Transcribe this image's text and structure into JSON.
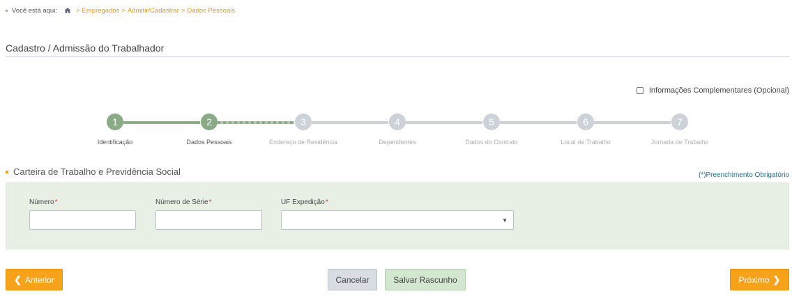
{
  "breadcrumb": {
    "prefix": "Você está aqui:",
    "items": [
      "Empregados",
      "Admitir/Cadastrar",
      "Dados Pessoais"
    ],
    "separator": ">"
  },
  "page_title": "Cadastro / Admissão do Trabalhador",
  "complementary": {
    "label": "Informações Complementares (Opcional)",
    "checked": false
  },
  "steps": [
    {
      "number": "1",
      "label": "Identificação",
      "status": "done"
    },
    {
      "number": "2",
      "label": "Dados Pessoais",
      "status": "done"
    },
    {
      "number": "3",
      "label": "Endereço de Residência",
      "status": "todo"
    },
    {
      "number": "4",
      "label": "Dependentes",
      "status": "todo"
    },
    {
      "number": "5",
      "label": "Dados do Contrato",
      "status": "todo"
    },
    {
      "number": "6",
      "label": "Local de Trabalho",
      "status": "todo"
    },
    {
      "number": "7",
      "label": "Jornada de Trabalho",
      "status": "todo"
    }
  ],
  "section": {
    "title": "Carteira de Trabalho e Previdência Social",
    "required_note": "(*)Preenchimento Obrigatório"
  },
  "fields": {
    "numero": {
      "label": "Número",
      "required_mark": "*",
      "value": ""
    },
    "serie": {
      "label": "Número de Série",
      "required_mark": "*",
      "value": ""
    },
    "uf": {
      "label": "UF Expedição",
      "required_mark": "*",
      "value": ""
    }
  },
  "buttons": {
    "previous": "Anterior",
    "cancel": "Cancelar",
    "save_draft": "Salvar Rascunho",
    "next": "Próximo"
  },
  "icons": {
    "home": "home-icon",
    "select_arrow": "▼",
    "previous": "❮",
    "next": "❯"
  },
  "colors": {
    "accent_orange": "#f7a21b",
    "step_done": "#8aab86",
    "step_todo": "#cdd2d8",
    "panel_bg": "#e8f0e6",
    "link_orange": "#e8971e",
    "required_blue": "#1f6f8b"
  }
}
